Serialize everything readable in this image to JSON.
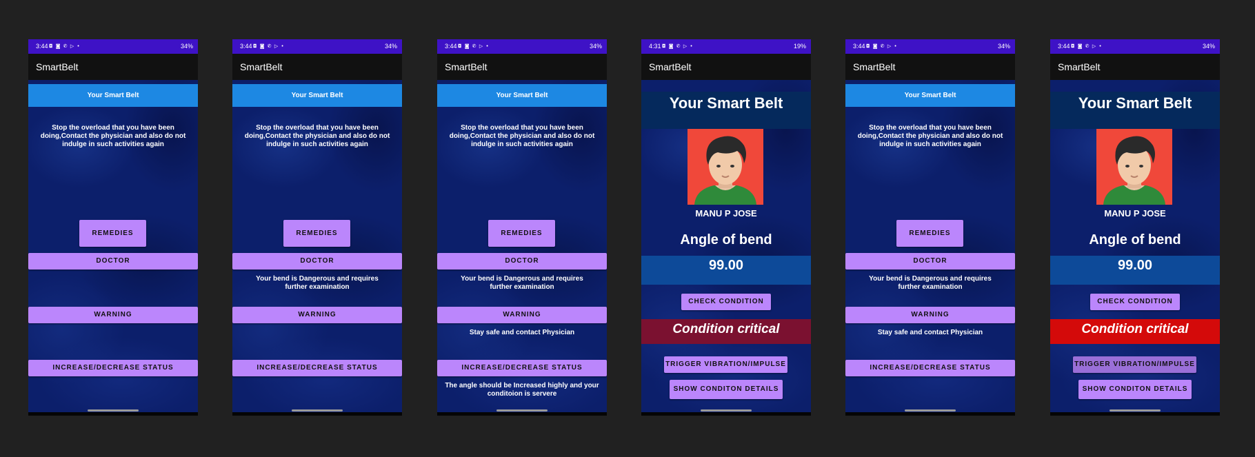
{
  "app_title": "SmartBelt",
  "status_icons": "◘ ◙ ✆ ▷ •",
  "screens": [
    {
      "time": "3:44",
      "battery": "34%",
      "title": "Your Smart Belt",
      "message": "Stop the overload that you have been doing,Contact the physician and also do not indulge in such activities again",
      "remedies": "REMEDIES",
      "doctor": "DOCTOR",
      "warning": "WARNING",
      "status": "INCREASE/DECREASE STATUS"
    },
    {
      "time": "3:44",
      "battery": "34%",
      "title": "Your Smart Belt",
      "message": "Stop the overload that you have been doing,Contact the physician and also do not indulge in such activities again",
      "remedies": "REMEDIES",
      "doctor": "DOCTOR",
      "doctor_text": "Your bend is Dangerous and requires further examination",
      "warning": "WARNING",
      "status": "INCREASE/DECREASE STATUS"
    },
    {
      "time": "3:44",
      "battery": "34%",
      "title": "Your Smart Belt",
      "message": "Stop the overload that you have been doing,Contact the physician and also do not indulge in such activities again",
      "remedies": "REMEDIES",
      "doctor": "DOCTOR",
      "doctor_text": "Your bend is Dangerous and requires further examination",
      "warning": "WARNING",
      "warning_text": "Stay safe and contact Physician",
      "status": "INCREASE/DECREASE STATUS",
      "status_text": "The angle should be Increased highly and your conditoion is servere"
    },
    {
      "time": "4:31",
      "battery": "19%",
      "title": "Your Smart Belt",
      "name": "MANU P JOSE",
      "angle_label": "Angle of bend",
      "angle_value": "99.00",
      "check": "CHECK CONDITION",
      "condition": "Condition critical",
      "trigger": "TRIGGER VIBRATION/IMPULSE",
      "details": "SHOW CONDITON DETAILS",
      "condition_color": "#7b1130"
    },
    {
      "time": "3:44",
      "battery": "34%",
      "title": "Your Smart Belt",
      "message": "Stop the overload that you have been doing,Contact the physician and also do not indulge in such activities again",
      "remedies": "REMEDIES",
      "doctor": "DOCTOR",
      "doctor_text": "Your bend is Dangerous and requires further examination",
      "warning": "WARNING",
      "warning_text": "Stay safe and contact Physician",
      "status": "INCREASE/DECREASE STATUS"
    },
    {
      "time": "3:44",
      "battery": "34%",
      "title": "Your Smart Belt",
      "name": "MANU P JOSE",
      "angle_label": "Angle of bend",
      "angle_value": "99.00",
      "check": "CHECK CONDITION",
      "condition": "Condition critical",
      "trigger": "TRIGGER VIBRATION/IMPULSE",
      "details": "SHOW CONDITON DETAILS",
      "condition_color": "#d40a0a"
    }
  ],
  "colors": {
    "status_bar": "#3e12c6",
    "accent_button": "#bb86fc",
    "title_bar": "#1d88e3",
    "avatar_bg": "#f0483a"
  }
}
